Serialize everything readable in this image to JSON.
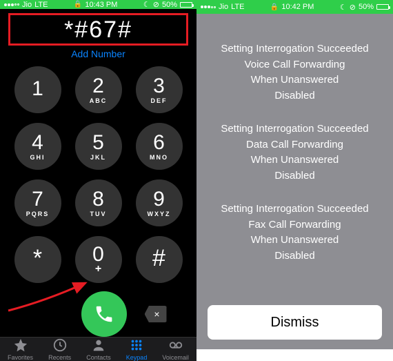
{
  "status_bar": {
    "carrier": "Jio",
    "network": "LTE",
    "time_left": "10:43 PM",
    "time_right": "10:42 PM",
    "dnd_icon": "moon-icon",
    "alarm_icon": "alarm-icon",
    "battery_pct": "50%"
  },
  "dialer": {
    "entered_number": "*#67#",
    "add_number_label": "Add Number",
    "keys": [
      {
        "digit": "1",
        "letters": ""
      },
      {
        "digit": "2",
        "letters": "ABC"
      },
      {
        "digit": "3",
        "letters": "DEF"
      },
      {
        "digit": "4",
        "letters": "GHI"
      },
      {
        "digit": "5",
        "letters": "JKL"
      },
      {
        "digit": "6",
        "letters": "MNO"
      },
      {
        "digit": "7",
        "letters": "PQRS"
      },
      {
        "digit": "8",
        "letters": "TUV"
      },
      {
        "digit": "9",
        "letters": "WXYZ"
      },
      {
        "digit": "*",
        "letters": ""
      },
      {
        "digit": "0",
        "letters": "+"
      },
      {
        "digit": "#",
        "letters": ""
      }
    ],
    "delete_glyph": "×"
  },
  "tabs": {
    "favorites": "Favorites",
    "recents": "Recents",
    "contacts": "Contacts",
    "keypad": "Keypad",
    "voicemail": "Voicemail",
    "active": "keypad"
  },
  "result": {
    "blocks": [
      [
        "Setting Interrogation Succeeded",
        "Voice Call Forwarding",
        "When Unanswered",
        "Disabled"
      ],
      [
        "Setting Interrogation Succeeded",
        "Data Call Forwarding",
        "When Unanswered",
        "Disabled"
      ],
      [
        "Setting Interrogation Succeeded",
        "Fax Call Forwarding",
        "When Unanswered",
        "Disabled"
      ]
    ],
    "dismiss_label": "Dismiss"
  },
  "colors": {
    "status_green": "#2fce4a",
    "call_green": "#34c759",
    "ios_blue": "#0a84ff",
    "highlight_red": "#e51c23",
    "modal_gray": "#8e8e93"
  }
}
